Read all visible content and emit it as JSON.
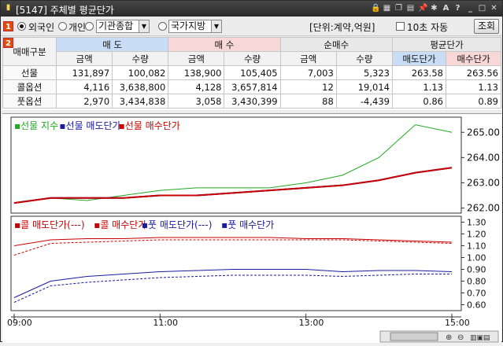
{
  "window": {
    "title": "[5147] 주체별 평균단가",
    "badge1": "1",
    "badge2": "2"
  },
  "toolbar": {
    "radio_foreign": "외국인",
    "radio_individual": "개인",
    "radio_institution": "기관종합",
    "institution_value": "기관종합",
    "region_value": "국가지방",
    "unit_text": "[단위:계약,억원]",
    "auto_label": "10초 자동",
    "query_button": "조회"
  },
  "table": {
    "row_header": "매매구분",
    "groups": [
      "매 도",
      "매 수",
      "순매수",
      "평균단가"
    ],
    "subheaders": [
      "금액",
      "수량",
      "금액",
      "수량",
      "금액",
      "수량",
      "매도단가",
      "매수단가"
    ],
    "rows": [
      {
        "label": "선물",
        "cells": [
          "131,897",
          "100,082",
          "138,900",
          "105,405",
          "7,003",
          "5,323",
          "263.58",
          "263.56"
        ]
      },
      {
        "label": "콜옵션",
        "cells": [
          "4,116",
          "3,638,800",
          "4,128",
          "3,657,814",
          "12",
          "19,014",
          "1.13",
          "1.13"
        ]
      },
      {
        "label": "풋옵션",
        "cells": [
          "2,970",
          "3,434,838",
          "3,058",
          "3,430,399",
          "88",
          "-4,439",
          "0.86",
          "0.89"
        ]
      }
    ]
  },
  "chart_data": [
    {
      "type": "line",
      "legend": [
        "▪선물 지수",
        "▪선물 매도단가",
        "▪선물 매수단가"
      ],
      "colors": [
        "#22a822",
        "#1a1aa0",
        "#c80000"
      ],
      "y_ticks": [
        "265.00",
        "264.00",
        "263.00",
        "262.00"
      ],
      "ylim": [
        261.8,
        265.6
      ],
      "x": [
        "09:00",
        "09:30",
        "10:00",
        "10:30",
        "11:00",
        "11:30",
        "12:00",
        "12:30",
        "13:00",
        "13:30",
        "14:00",
        "14:30",
        "15:00"
      ],
      "series": [
        {
          "name": "선물 지수",
          "values": [
            262.2,
            262.4,
            262.3,
            262.5,
            262.7,
            262.8,
            262.8,
            262.8,
            263.0,
            263.3,
            264.0,
            265.3,
            265.0
          ]
        },
        {
          "name": "선물 매도단가",
          "values": [
            262.2,
            262.4,
            262.4,
            262.4,
            262.5,
            262.5,
            262.6,
            262.7,
            262.8,
            262.9,
            263.1,
            263.4,
            263.6
          ]
        },
        {
          "name": "선물 매수단가",
          "values": [
            262.2,
            262.4,
            262.4,
            262.4,
            262.5,
            262.5,
            262.6,
            262.7,
            262.8,
            262.9,
            263.1,
            263.4,
            263.6
          ]
        }
      ]
    },
    {
      "type": "line",
      "legend": [
        "▪콜 매도단가(---)",
        "▪콜 매수단가",
        "▪풋 매도단가(---)",
        "▪풋 매수단가"
      ],
      "colors": [
        "#c80000",
        "#c80000",
        "#1a1aa0",
        "#1a1aa0"
      ],
      "y_ticks": [
        "1.30",
        "1.20",
        "1.10",
        "1.00",
        "0.90",
        "0.80",
        "0.70",
        "0.60"
      ],
      "ylim": [
        0.55,
        1.35
      ],
      "x_labels": [
        "09:00",
        "11:00",
        "13:00",
        "15:00"
      ],
      "x": [
        "09:00",
        "09:30",
        "10:00",
        "10:30",
        "11:00",
        "11:30",
        "12:00",
        "12:30",
        "13:00",
        "13:30",
        "14:00",
        "14:30",
        "15:00"
      ],
      "series": [
        {
          "name": "콜 매도단가(---)",
          "values": [
            1.02,
            1.12,
            1.13,
            1.14,
            1.15,
            1.15,
            1.15,
            1.15,
            1.15,
            1.15,
            1.14,
            1.13,
            1.12
          ]
        },
        {
          "name": "콜 매수단가",
          "values": [
            1.1,
            1.15,
            1.16,
            1.16,
            1.17,
            1.17,
            1.17,
            1.17,
            1.16,
            1.16,
            1.15,
            1.14,
            1.13
          ]
        },
        {
          "name": "풋 매도단가(---)",
          "values": [
            0.62,
            0.76,
            0.79,
            0.81,
            0.83,
            0.84,
            0.85,
            0.85,
            0.85,
            0.84,
            0.85,
            0.86,
            0.86
          ]
        },
        {
          "name": "풋 매수단가",
          "values": [
            0.66,
            0.8,
            0.84,
            0.86,
            0.88,
            0.89,
            0.9,
            0.9,
            0.9,
            0.88,
            0.89,
            0.89,
            0.88
          ]
        }
      ]
    }
  ]
}
